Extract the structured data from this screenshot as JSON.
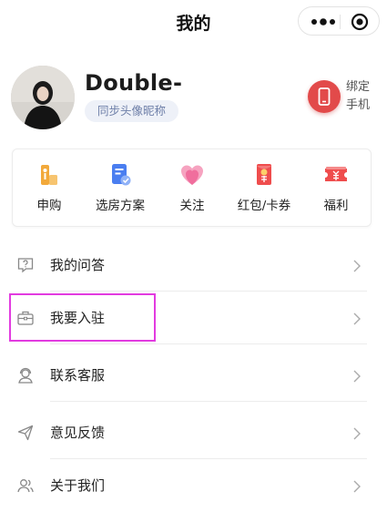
{
  "header": {
    "title": "我的",
    "more_icon": "more-dots-icon",
    "close_icon": "close-circle-icon"
  },
  "profile": {
    "username": "Double-",
    "sync_button": "同步头像昵称",
    "bind_label_line1": "绑定",
    "bind_label_line2": "手机",
    "bind_icon": "phone-icon",
    "accent": "#e24a4a"
  },
  "quick_actions": [
    {
      "label": "申购",
      "icon": "key-icon",
      "color": "#f2a93b"
    },
    {
      "label": "选房方案",
      "icon": "plan-document-icon",
      "color": "#4a7ef0"
    },
    {
      "label": "关注",
      "icon": "heart-icon",
      "color": "#f06e9d"
    },
    {
      "label": "红包/卡券",
      "icon": "red-envelope-icon",
      "color": "#ef4d4d"
    },
    {
      "label": "福利",
      "icon": "coupon-icon",
      "color": "#ef4d4d"
    }
  ],
  "menu": [
    {
      "label": "我的问答",
      "icon": "question-icon"
    },
    {
      "label": "我要入驻",
      "icon": "briefcase-icon"
    },
    {
      "label": "联系客服",
      "icon": "customer-service-icon"
    },
    {
      "label": "意见反馈",
      "icon": "send-feedback-icon"
    },
    {
      "label": "关于我们",
      "icon": "users-icon"
    }
  ],
  "highlight_color": "#e23be0"
}
